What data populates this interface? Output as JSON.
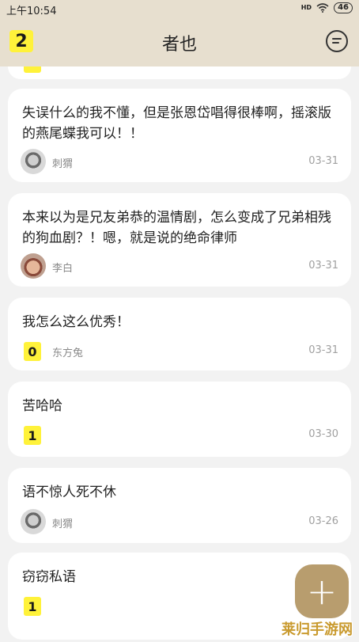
{
  "status_bar": {
    "time": "上午10:54",
    "network": "HD",
    "battery": "46"
  },
  "header": {
    "title": "者也",
    "level": "2",
    "chat_icon": "chat-bubble-icon"
  },
  "posts": [
    {
      "text": "失误什么的我不懂，但是张恩岱唱得很棒啊，摇滚版的燕尾蝶我可以！！",
      "author": "刺猬",
      "date": "03-31",
      "badge": ""
    },
    {
      "text": "本来以为是兄友弟恭的温情剧，怎么变成了兄弟相残的狗血剧？！嗯，就是说的绝命律师",
      "author": "李白",
      "date": "03-31",
      "badge": ""
    },
    {
      "text": "我怎么这么优秀！",
      "author": "东方兔",
      "date": "03-31",
      "badge": "0"
    },
    {
      "text": "苦哈哈",
      "author": "",
      "date": "03-30",
      "badge": "1"
    },
    {
      "text": "语不惊人死不休",
      "author": "刺猬",
      "date": "03-26",
      "badge": ""
    },
    {
      "text": "窃窃私语",
      "author": "",
      "date": "",
      "badge": "1"
    }
  ],
  "fab": {
    "label": "+"
  },
  "watermark": "莱归手游网",
  "colors": {
    "header_bg": "#e7dfcf",
    "badge_yellow": "#fff23a",
    "fab": "#b89d6e"
  }
}
